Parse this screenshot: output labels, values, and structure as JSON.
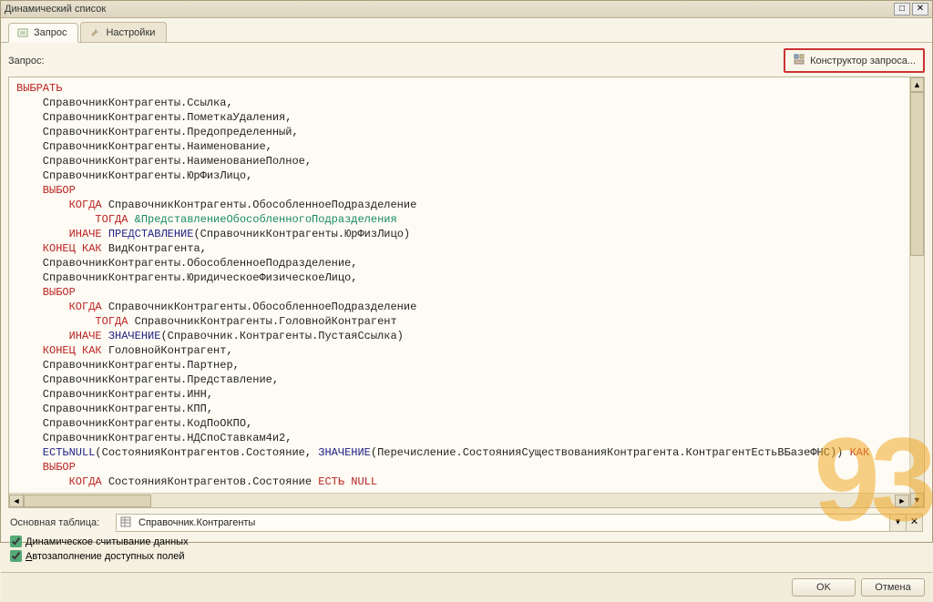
{
  "window": {
    "title": "Динамический список"
  },
  "tabs": {
    "query": "Запрос",
    "settings": "Настройки"
  },
  "labels": {
    "query": "Запрос:",
    "query_constructor": "Конструктор запроса...",
    "main_table": "Основная таблица:",
    "dynamic_read": "Динамическое считывание данных",
    "autofill": "Автозаполнение доступных полей"
  },
  "main_table_value": "Справочник.Контрагенты",
  "checks": {
    "dynamic_read": true,
    "autofill": true
  },
  "buttons": {
    "ok": "OK",
    "cancel": "Отмена"
  },
  "watermark": "93",
  "code": {
    "l1": "ВЫБРАТЬ",
    "l2": "    СправочникКонтрагенты.Ссылка,",
    "l3": "    СправочникКонтрагенты.ПометкаУдаления,",
    "l4": "    СправочникКонтрагенты.Предопределенный,",
    "l5": "    СправочникКонтрагенты.Наименование,",
    "l6": "    СправочникКонтрагенты.НаименованиеПолное,",
    "l7": "    СправочникКонтрагенты.ЮрФизЛицо,",
    "l8": "    ВЫБОР",
    "l9a": "        КОГДА",
    "l9b": " СправочникКонтрагенты.ОбособленноеПодразделение",
    "l10a": "            ТОГДА ",
    "l10b": "&ПредставлениеОбособленногоПодразделения",
    "l11a": "        ИНАЧЕ ",
    "l11b": "ПРЕДСТАВЛЕНИЕ",
    "l11c": "(СправочникКонтрагенты.ЮрФизЛицо)",
    "l12a": "    КОНЕЦ КАК",
    "l12b": " ВидКонтрагента,",
    "l13": "    СправочникКонтрагенты.ОбособленноеПодразделение,",
    "l14": "    СправочникКонтрагенты.ЮридическоеФизическоеЛицо,",
    "l15": "    ВЫБОР",
    "l16a": "        КОГДА",
    "l16b": " СправочникКонтрагенты.ОбособленноеПодразделение",
    "l17a": "            ТОГДА",
    "l17b": " СправочникКонтрагенты.ГоловнойКонтрагент",
    "l18a": "        ИНАЧЕ ",
    "l18b": "ЗНАЧЕНИЕ",
    "l18c": "(Справочник.Контрагенты.ПустаяСсылка)",
    "l19a": "    КОНЕЦ КАК",
    "l19b": " ГоловнойКонтрагент,",
    "l20": "    СправочникКонтрагенты.Партнер,",
    "l21": "    СправочникКонтрагенты.Представление,",
    "l22": "    СправочникКонтрагенты.ИНН,",
    "l23": "    СправочникКонтрагенты.КПП,",
    "l24": "    СправочникКонтрагенты.КодПоОКПО,",
    "l25": "    СправочникКонтрагенты.НДСпоСтавкам4и2,",
    "l26a": "    ЕСТЬNULL",
    "l26b": "(СостоянияКонтрагентов.Состояние, ",
    "l26c": "ЗНАЧЕНИЕ",
    "l26d": "(Перечисление.СостоянияСуществованияКонтрагента.КонтрагентЕстьВБазеФНС)) ",
    "l26e": "КАК",
    "l27": "    ВЫБОР",
    "l28a": "        КОГДА",
    "l28b": " СостоянияКонтрагентов.Состояние ",
    "l28c": "ЕСТЬ NULL"
  }
}
